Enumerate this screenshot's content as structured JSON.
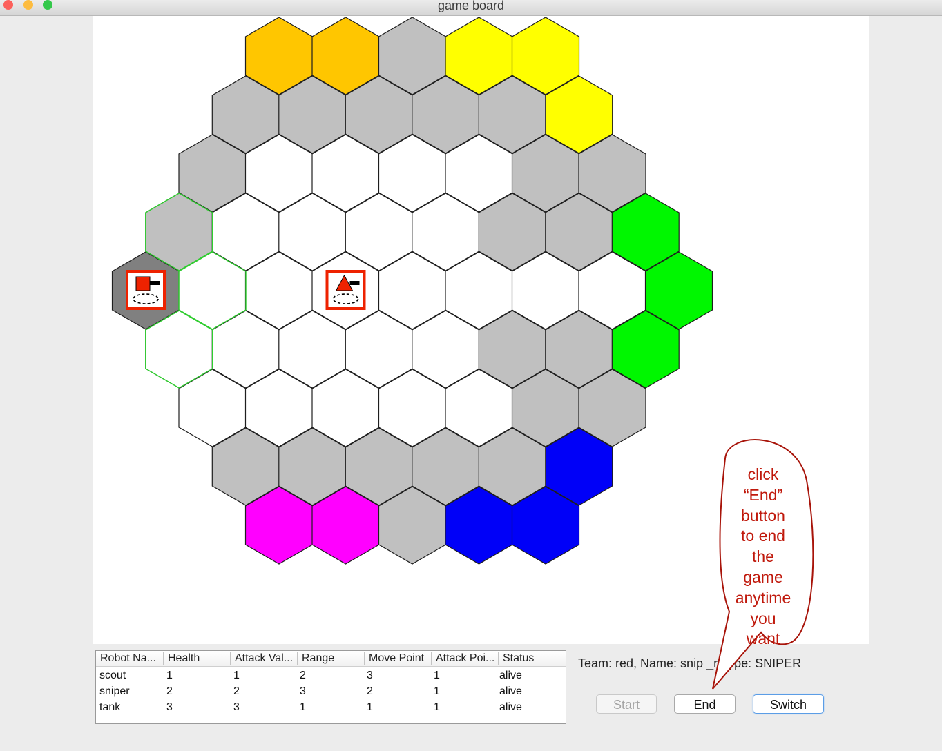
{
  "window": {
    "title": "game board"
  },
  "board": {
    "colors": {
      "orange": "#ffc600",
      "yellow": "#ffff00",
      "green": "#00f700",
      "blue": "#0000f8",
      "magenta": "#ff00ff",
      "gray": "#c0c0c0",
      "dark": "#808080",
      "white": "#ffffff",
      "outline": "#1e1e1e",
      "highlight": "#2fd02f"
    },
    "robots": [
      {
        "name": "robot-square",
        "shape": "square",
        "hex": [
          0,
          -4
        ]
      },
      {
        "name": "robot-triangle",
        "shape": "triangle",
        "hex": [
          0,
          -1
        ]
      }
    ]
  },
  "table": {
    "headers": [
      "Robot Na...",
      "Health",
      "Attack Val...",
      "Range",
      "Move Point",
      "Attack Poi...",
      "Status"
    ],
    "rows": [
      [
        "scout",
        "1",
        "1",
        "2",
        "3",
        "1",
        "alive"
      ],
      [
        "sniper",
        "2",
        "2",
        "3",
        "2",
        "1",
        "alive"
      ],
      [
        "tank",
        "3",
        "3",
        "1",
        "1",
        "1",
        "alive"
      ]
    ]
  },
  "info": {
    "text": "Team: red,  Name: snip      _re      ype: SNIPER"
  },
  "buttons": {
    "start": "Start",
    "end": "End",
    "switch": "Switch"
  },
  "callout": {
    "lines": [
      "click",
      "“End”",
      "button",
      "to end",
      "the",
      "game",
      "anytime",
      "you",
      "want"
    ]
  }
}
